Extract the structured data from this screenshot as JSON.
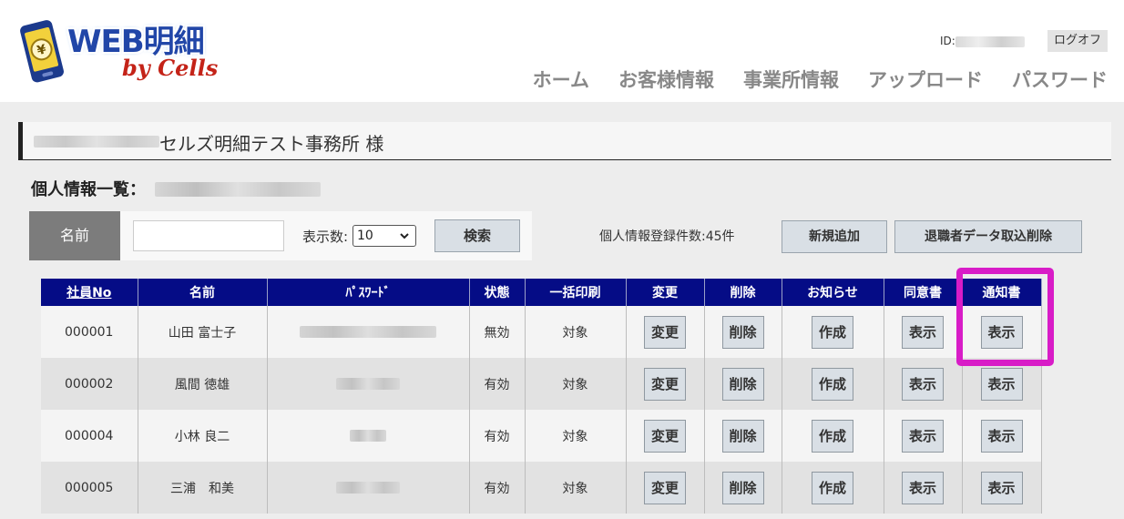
{
  "header": {
    "logo_text": "WEB明細",
    "logo_sub": "by Cells",
    "user_id_label": "ID:",
    "logoff_label": "ログオフ",
    "nav": [
      "ホーム",
      "お客様情報",
      "事業所情報",
      "アップロード",
      "パスワード"
    ]
  },
  "office": {
    "name": "セルズ明細テスト事務所 様"
  },
  "list_title": "個人情報一覧：",
  "search": {
    "label": "名前",
    "name_value": "",
    "per_page_label": "表示数:",
    "per_page_value": "10",
    "search_button": "検索"
  },
  "registration_count": "個人情報登録件数:45件",
  "buttons": {
    "new": "新規追加",
    "retire_import_delete": "退職者データ取込削除"
  },
  "table": {
    "headers": [
      "社員No",
      "名前",
      "ﾊﾟｽﾜｰﾄﾞ",
      "状態",
      "一括印刷",
      "変更",
      "削除",
      "お知らせ",
      "同意書",
      "通知書"
    ],
    "rows": [
      {
        "no": "000001",
        "name": "山田 富士子",
        "status": "無効",
        "bulk": "対象",
        "edit": "変更",
        "del": "削除",
        "notice": "作成",
        "consent": "表示",
        "notif": "表示"
      },
      {
        "no": "000002",
        "name": "風間 徳雄",
        "status": "有効",
        "bulk": "対象",
        "edit": "変更",
        "del": "削除",
        "notice": "作成",
        "consent": "表示",
        "notif": "表示"
      },
      {
        "no": "000004",
        "name": "小林 良二",
        "status": "有効",
        "bulk": "対象",
        "edit": "変更",
        "del": "削除",
        "notice": "作成",
        "consent": "表示",
        "notif": "表示"
      },
      {
        "no": "000005",
        "name": "三浦　和美",
        "status": "有効",
        "bulk": "対象",
        "edit": "変更",
        "del": "削除",
        "notice": "作成",
        "consent": "表示",
        "notif": "表示"
      }
    ]
  },
  "colors": {
    "table_header": "#050c86",
    "highlight": "#d81cc7",
    "nav_text": "#888888"
  }
}
